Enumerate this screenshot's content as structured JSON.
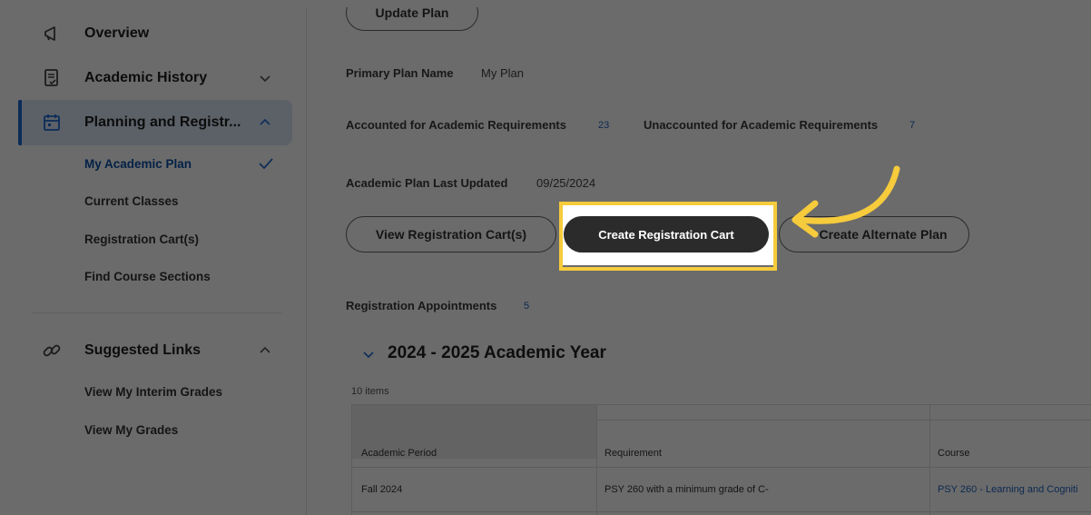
{
  "sidebar": {
    "items": [
      {
        "label": "Overview",
        "icon": "megaphone-icon"
      },
      {
        "label": "Academic History",
        "icon": "document-check-icon"
      },
      {
        "label": "Planning and Registr...",
        "icon": "calendar-icon"
      },
      {
        "label": "Suggested Links",
        "icon": "link-icon"
      }
    ],
    "planning_sub": [
      "My Academic Plan",
      "Current Classes",
      "Registration Cart(s)",
      "Find Course Sections"
    ],
    "links_sub": [
      "View My Interim Grades",
      "View My Grades"
    ]
  },
  "main": {
    "update_plan_label": "Update Plan",
    "primary_plan_label": "Primary Plan Name",
    "primary_plan_value": "My Plan",
    "accounted_label": "Accounted for Academic Requirements",
    "accounted_value": "23",
    "unaccounted_label": "Unaccounted for Academic Requirements",
    "unaccounted_value": "7",
    "last_updated_label": "Academic Plan Last Updated",
    "last_updated_value": "09/25/2024",
    "view_cart_label": "View Registration Cart(s)",
    "create_cart_label": "Create Registration Cart",
    "create_alt_label": "Create Alternate Plan",
    "appointments_label": "Registration Appointments",
    "appointments_value": "5",
    "section_title": "2024 - 2025 Academic Year",
    "items_count": "10 items",
    "table": {
      "headers": [
        "Academic Period",
        "Requirement",
        "Course"
      ],
      "rows": [
        [
          "Fall 2024",
          "PSY 260 with a minimum grade of C-",
          "PSY 260 - Learning and Cogniti"
        ]
      ]
    }
  },
  "colors": {
    "highlight": "#f6cb3c",
    "accent": "#1f6bd1",
    "dark_button": "#2b2b2b"
  }
}
